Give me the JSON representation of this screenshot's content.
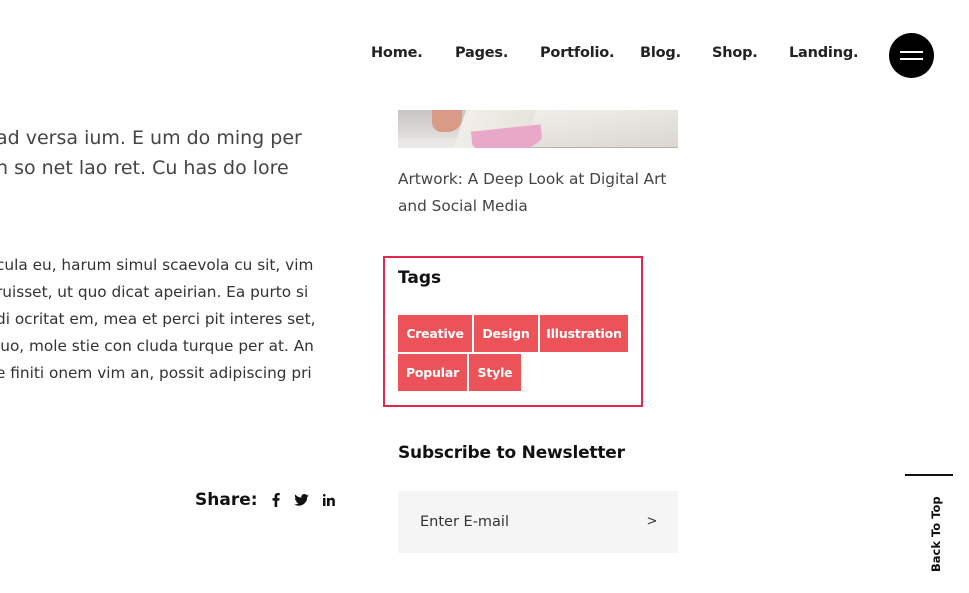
{
  "nav": {
    "items": [
      {
        "label": "Home."
      },
      {
        "label": "Pages."
      },
      {
        "label": "Portfolio."
      },
      {
        "label": "Blog."
      },
      {
        "label": "Shop."
      },
      {
        "label": "Landing."
      }
    ],
    "menu_icon": "hamburger-menu-icon"
  },
  "article": {
    "lead_lines": [
      "ad versa ium. E um do ming per",
      "n so net lao ret. Cu has do lore"
    ],
    "body_lines": [
      "cula eu, harum simul scaevola cu sit, vim",
      "ruisset, ut quo dicat apeirian. Ea purto si",
      "di ocritat em, mea et perci pit interes set,",
      "luo, mole stie con cluda turque per at. An",
      "e finiti onem vim an, possit adipiscing pri"
    ],
    "share": {
      "label": "Share:",
      "icons": [
        {
          "name": "facebook-icon",
          "glyph": "f"
        },
        {
          "name": "twitter-icon",
          "glyph": "🐦"
        },
        {
          "name": "linkedin-icon",
          "glyph": "in"
        }
      ]
    }
  },
  "sidebar": {
    "recent_post": {
      "title": "Artwork: A Deep Look at Digital Art and Social Media"
    },
    "tags": {
      "title": "Tags",
      "items": [
        "Creative",
        "Design",
        "Illustration",
        "Popular",
        "Style"
      ],
      "color": "#eb5359",
      "highlight_border": "#e0284e"
    },
    "newsletter": {
      "title": "Subscribe to Newsletter",
      "placeholder": "Enter E-mail",
      "submit_glyph": ">"
    }
  },
  "back_to_top": {
    "label": "Back To Top"
  }
}
